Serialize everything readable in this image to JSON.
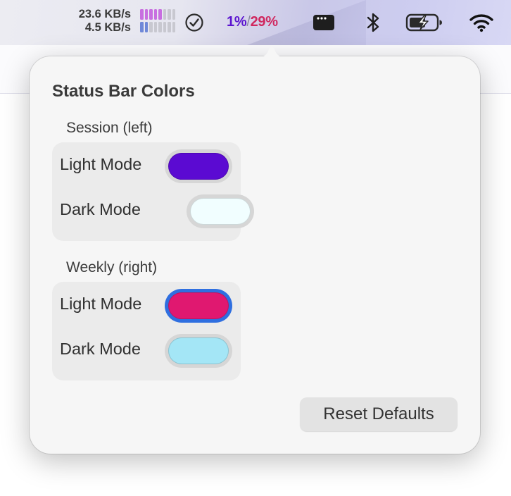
{
  "menubar": {
    "network": {
      "upload": "23.6 KB/s",
      "download": "4.5 KB/s"
    },
    "usage": {
      "session": "1%",
      "separator": "/",
      "weekly": "29%",
      "session_color": "#5b14d0",
      "weekly_color": "#d0285f"
    },
    "icons": [
      "network-activity-bars-icon",
      "checkmark-circle-icon",
      "app-window-icon",
      "bluetooth-icon",
      "battery-charging-icon",
      "wifi-icon"
    ]
  },
  "popover": {
    "title": "Status Bar Colors",
    "groups": [
      {
        "label": "Session (left)",
        "rows": [
          {
            "label": "Light Mode",
            "color": "#5b0ad2",
            "selected": false
          },
          {
            "label": "Dark Mode",
            "color": "#f1feff",
            "selected": false
          }
        ]
      },
      {
        "label": "Weekly (right)",
        "rows": [
          {
            "label": "Light Mode",
            "color": "#e01870",
            "selected": true
          },
          {
            "label": "Dark Mode",
            "color": "#a4e6f6",
            "selected": false
          }
        ]
      }
    ],
    "reset_label": "Reset Defaults"
  }
}
